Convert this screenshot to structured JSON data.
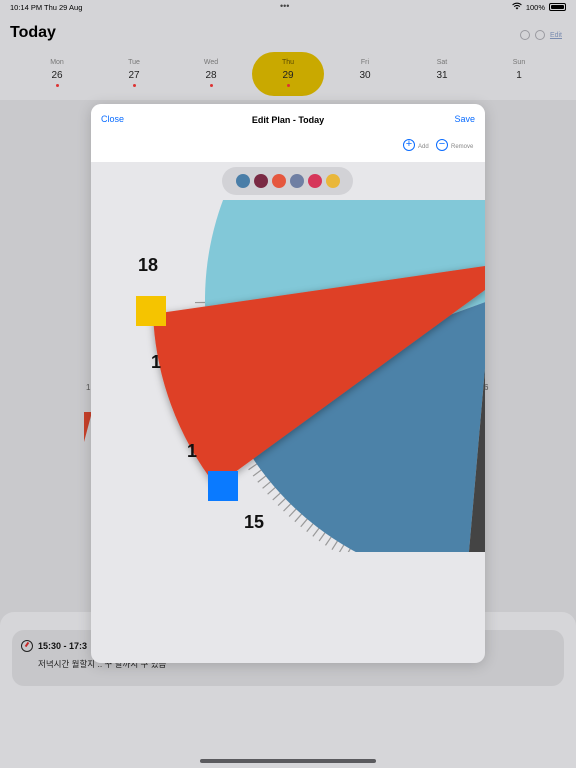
{
  "status_bar": {
    "time": "10:14 PM",
    "date": "Thu 29 Aug",
    "dots": "•••",
    "battery": "100%"
  },
  "header": {
    "title": "Today",
    "edit_label": "Edit"
  },
  "week": [
    {
      "name": "Mon",
      "date": "26",
      "dot": true,
      "selected": false
    },
    {
      "name": "Tue",
      "date": "27",
      "dot": true,
      "selected": false
    },
    {
      "name": "Wed",
      "date": "28",
      "dot": true,
      "selected": false
    },
    {
      "name": "Thu",
      "date": "29",
      "dot": true,
      "selected": true
    },
    {
      "name": "Fri",
      "date": "30",
      "dot": false,
      "selected": false
    },
    {
      "name": "Sat",
      "date": "31",
      "dot": false,
      "selected": false
    },
    {
      "name": "Sun",
      "date": "1",
      "dot": false,
      "selected": false
    }
  ],
  "background": {
    "left_label": "1",
    "right_label": "6"
  },
  "plan": {
    "time": "15:30 - 17:3",
    "description": "저녁시간 월할지 .. 꾸 날까지 구 있음"
  },
  "modal": {
    "close_label": "Close",
    "title": "Edit Plan - Today",
    "save_label": "Save",
    "add_label": "Add",
    "remove_label": "Remove"
  },
  "palette": [
    "#4a7ea8",
    "#7a2a44",
    "#e5573e",
    "#6f7fa3",
    "#d6365a",
    "#e9b73a"
  ],
  "clock": {
    "labels": {
      "h18": "18",
      "h15": "15",
      "h16": "1",
      "h17": "1"
    },
    "segment_colors": {
      "teal": "#82c8d8",
      "blue": "#4c82a8",
      "red": "#de4027",
      "dark": "#444444"
    },
    "handles": {
      "start_color": "#f5c400",
      "end_color": "#0a7aff"
    }
  }
}
